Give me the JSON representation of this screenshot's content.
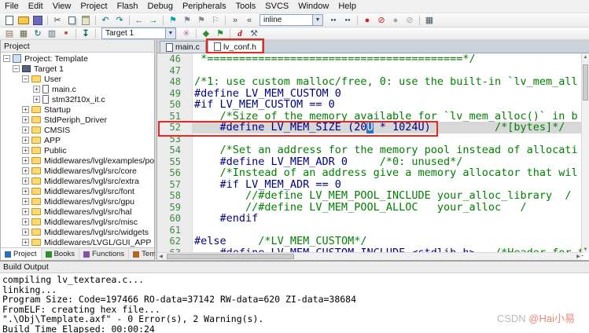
{
  "menu": {
    "items": [
      "File",
      "Edit",
      "View",
      "Project",
      "Flash",
      "Debug",
      "Peripherals",
      "Tools",
      "SVCS",
      "Window",
      "Help"
    ]
  },
  "toolbar_top": {
    "search_value": "inline",
    "icons": [
      "new-file",
      "open",
      "save",
      "cut",
      "copy",
      "paste",
      "undo",
      "redo",
      "navigate-back",
      "navigate-forward",
      "bookmark-toggle",
      "bookmark-previous",
      "bookmark-next",
      "bookmark-clear-all",
      "indent",
      "unindent",
      "find-in-files",
      "find",
      "insert-breakpoint",
      "kill-all-breakpoints",
      "enable-disable-breakpoint",
      "disable-all-breakpoints",
      "debug-windows"
    ]
  },
  "toolbar_build": {
    "target_value": "Target 1",
    "icons": [
      "translate",
      "build",
      "rebuild",
      "batch-build",
      "stop-build",
      "download-to-flash",
      "options-for-target",
      "manage-rte",
      "manage-project-items",
      "start-stop-debug",
      "configure"
    ]
  },
  "project_panel": {
    "title": "Project",
    "items": [
      {
        "label": "Project: Template",
        "depth": 0,
        "kind": "workspace",
        "exp": "minus"
      },
      {
        "label": "Target 1",
        "depth": 1,
        "kind": "target",
        "exp": "minus"
      },
      {
        "label": "User",
        "depth": 2,
        "kind": "folder",
        "exp": "minus"
      },
      {
        "label": "main.c",
        "depth": 3,
        "kind": "file",
        "exp": "plus"
      },
      {
        "label": "stm32f10x_it.c",
        "depth": 3,
        "kind": "file",
        "exp": "plus"
      },
      {
        "label": "Startup",
        "depth": 2,
        "kind": "folder",
        "exp": "plus"
      },
      {
        "label": "StdPeriph_Driver",
        "depth": 2,
        "kind": "folder",
        "exp": "plus"
      },
      {
        "label": "CMSIS",
        "depth": 2,
        "kind": "folder",
        "exp": "plus"
      },
      {
        "label": "APP",
        "depth": 2,
        "kind": "folder",
        "exp": "plus"
      },
      {
        "label": "Public",
        "depth": 2,
        "kind": "folder",
        "exp": "plus"
      },
      {
        "label": "Middlewares/lvgl/examples/porting",
        "depth": 2,
        "kind": "folder",
        "exp": "plus"
      },
      {
        "label": "Middlewares/lvgl/src/core",
        "depth": 2,
        "kind": "folder",
        "exp": "plus"
      },
      {
        "label": "Middlewares/lvgl/src/extra",
        "depth": 2,
        "kind": "folder",
        "exp": "plus"
      },
      {
        "label": "Middlewares/lvgl/src/font",
        "depth": 2,
        "kind": "folder",
        "exp": "plus"
      },
      {
        "label": "Middlewares/lvgl/src/gpu",
        "depth": 2,
        "kind": "folder",
        "exp": "plus"
      },
      {
        "label": "Middlewares/lvgl/src/hal",
        "depth": 2,
        "kind": "folder",
        "exp": "plus"
      },
      {
        "label": "Middlewares/lvgl/src/misc",
        "depth": 2,
        "kind": "folder",
        "exp": "plus"
      },
      {
        "label": "Middlewares/lvgl/src/widgets",
        "depth": 2,
        "kind": "folder",
        "exp": "plus"
      },
      {
        "label": "Middlewares/LVGL/GUI_APP",
        "depth": 2,
        "kind": "folder",
        "exp": "plus"
      }
    ],
    "tabs": [
      "Project",
      "Books",
      "Functions",
      "Templates"
    ]
  },
  "editor": {
    "tabs": [
      "main.c",
      "lv_conf.h"
    ],
    "active_tab": "lv_conf.h",
    "lines": [
      {
        "no": "46",
        "segs": [
          {
            "t": " *========================================*/",
            "k": "com"
          }
        ]
      },
      {
        "no": "47",
        "segs": []
      },
      {
        "no": "48",
        "segs": [
          {
            "t": "/*1: use custom malloc/free, 0: use the built-in `lv_mem_all",
            "k": "com"
          }
        ]
      },
      {
        "no": "49",
        "segs": [
          {
            "t": "#define LV_MEM_CUSTOM 0",
            "k": "code"
          }
        ]
      },
      {
        "no": "50",
        "segs": [
          {
            "t": "#if LV_MEM_CUSTOM == 0",
            "k": "code"
          }
        ]
      },
      {
        "no": "51",
        "segs": [
          {
            "t": "    /*Size of the memory available for `lv_mem_alloc()` in b",
            "k": "com"
          }
        ]
      },
      {
        "no": "52",
        "segs": [
          {
            "t": "    #define LV_MEM_SIZE (20",
            "k": "code"
          },
          {
            "t": "U",
            "k": "sel"
          },
          {
            "t": " * 1024U)          ",
            "k": "code"
          },
          {
            "t": "/*[bytes]*/",
            "k": "com"
          }
        ]
      },
      {
        "no": "53",
        "segs": []
      },
      {
        "no": "54",
        "segs": [
          {
            "t": "    /*Set an address for the memory pool instead of allocati",
            "k": "com"
          }
        ]
      },
      {
        "no": "55",
        "segs": [
          {
            "t": "    #define LV_MEM_ADR 0     ",
            "k": "code"
          },
          {
            "t": "/*0: unused*/",
            "k": "com"
          }
        ]
      },
      {
        "no": "56",
        "segs": [
          {
            "t": "    /*Instead of an address give a memory allocator that wil",
            "k": "com"
          }
        ]
      },
      {
        "no": "57",
        "segs": [
          {
            "t": "    #if LV_MEM_ADR == 0",
            "k": "code"
          }
        ]
      },
      {
        "no": "58",
        "segs": [
          {
            "t": "        //#define LV_MEM_POOL_INCLUDE your_alloc_library  /",
            "k": "com"
          }
        ]
      },
      {
        "no": "59",
        "segs": [
          {
            "t": "        //#define LV_MEM_POOL_ALLOC   your_alloc   /",
            "k": "com"
          }
        ]
      },
      {
        "no": "60",
        "segs": [
          {
            "t": "    #endif",
            "k": "code"
          }
        ]
      },
      {
        "no": "61",
        "segs": []
      },
      {
        "no": "62",
        "segs": [
          {
            "t": "#else     ",
            "k": "code"
          },
          {
            "t": "/*LV_MEM_CUSTOM*/",
            "k": "com"
          }
        ]
      },
      {
        "no": "63",
        "segs": [
          {
            "t": "    #define LV_MEM_CUSTOM_INCLUDE <stdlib.h>   ",
            "k": "code"
          },
          {
            "t": "/*Header for t",
            "k": "com"
          }
        ]
      }
    ]
  },
  "build_output": {
    "title": "Build Output",
    "lines": [
      "compiling lv_textarea.c...",
      "linking...",
      "Program Size: Code=197466 RO-data=37142 RW-data=620 ZI-data=38684",
      "FromELF: creating hex file...",
      "\".\\Obj\\Template.axf\" - 0 Error(s), 2 Warning(s).",
      "Build Time Elapsed:  00:00:24"
    ]
  },
  "watermark": {
    "brand": "CSDN ",
    "user": "@Hai小易"
  },
  "colors": {
    "annotation": "#e8281e",
    "comment": "#027f02",
    "selection_bg": "#2f71c6",
    "current_line": "#d8d8d8",
    "code": "#000080"
  }
}
